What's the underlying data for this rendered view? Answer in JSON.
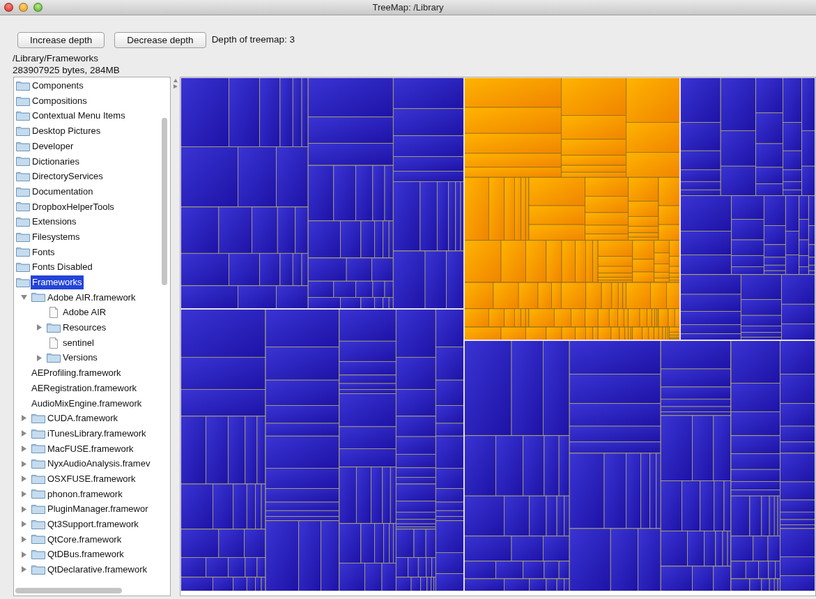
{
  "window": {
    "title": "TreeMap: /Library"
  },
  "toolbar": {
    "buttons": [
      "Increase depth",
      "Decrease depth"
    ],
    "depth_label": "Depth of treemap: 3"
  },
  "info": {
    "path": "/Library/Frameworks",
    "size": "283907925 bytes, 284MB"
  },
  "tree": [
    {
      "label": "Components",
      "kind": "folder",
      "selected": false
    },
    {
      "label": "Compositions",
      "kind": "folder",
      "selected": false
    },
    {
      "label": "Contextual Menu Items",
      "kind": "folder",
      "selected": false
    },
    {
      "label": "Desktop Pictures",
      "kind": "folder",
      "selected": false
    },
    {
      "label": "Developer",
      "kind": "folder",
      "selected": false
    },
    {
      "label": "Dictionaries",
      "kind": "folder",
      "selected": false
    },
    {
      "label": "DirectoryServices",
      "kind": "folder",
      "selected": false
    },
    {
      "label": "Documentation",
      "kind": "folder",
      "selected": false
    },
    {
      "label": "DropboxHelperTools",
      "kind": "folder",
      "selected": false
    },
    {
      "label": "Extensions",
      "kind": "folder",
      "selected": false
    },
    {
      "label": "Filesystems",
      "kind": "folder",
      "selected": false
    },
    {
      "label": "Fonts",
      "kind": "folder",
      "selected": false
    },
    {
      "label": "Fonts Disabled",
      "kind": "folder",
      "selected": false
    },
    {
      "label": "Frameworks",
      "kind": "folder",
      "selected": true,
      "children": [
        {
          "label": "Adobe AIR.framework",
          "kind": "folder",
          "selected": false,
          "expanded": true,
          "children": [
            {
              "label": "Adobe AIR",
              "kind": "file",
              "selected": false
            },
            {
              "label": "Resources",
              "kind": "folder",
              "selected": false,
              "expanded": false
            },
            {
              "label": "sentinel",
              "kind": "file",
              "selected": false
            },
            {
              "label": "Versions",
              "kind": "folder",
              "selected": false,
              "expanded": false
            }
          ]
        },
        {
          "label": "AEProfiling.framework",
          "kind": "none",
          "selected": false
        },
        {
          "label": "AERegistration.framework",
          "kind": "none",
          "selected": false
        },
        {
          "label": "AudioMixEngine.framework",
          "kind": "none",
          "selected": false
        },
        {
          "label": "CUDA.framework",
          "kind": "folder",
          "selected": false,
          "expanded": false
        },
        {
          "label": "iTunesLibrary.framework",
          "kind": "folder",
          "selected": false,
          "expanded": false
        },
        {
          "label": "MacFUSE.framework",
          "kind": "folder",
          "selected": false,
          "expanded": false
        },
        {
          "label": "NyxAudioAnalysis.framev",
          "kind": "folder",
          "selected": false,
          "expanded": false
        },
        {
          "label": "OSXFUSE.framework",
          "kind": "folder",
          "selected": false,
          "expanded": false
        },
        {
          "label": "phonon.framework",
          "kind": "folder",
          "selected": false,
          "expanded": false
        },
        {
          "label": "PluginManager.framewor",
          "kind": "folder",
          "selected": false,
          "expanded": false
        },
        {
          "label": "Qt3Support.framework",
          "kind": "folder",
          "selected": false,
          "expanded": false
        },
        {
          "label": "QtCore.framework",
          "kind": "folder",
          "selected": false,
          "expanded": false
        },
        {
          "label": "QtDBus.framework",
          "kind": "folder",
          "selected": false,
          "expanded": false
        },
        {
          "label": "QtDeclarative.framework",
          "kind": "folder",
          "selected": false,
          "expanded": false
        }
      ]
    }
  ]
}
